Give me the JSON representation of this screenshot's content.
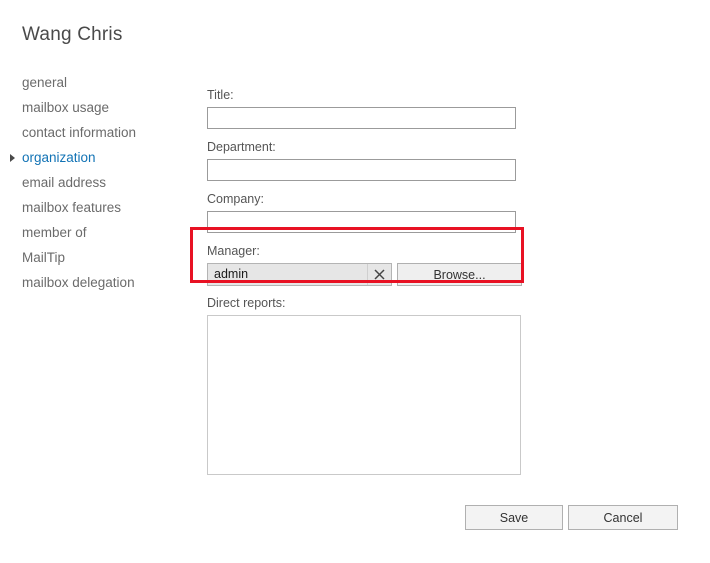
{
  "page": {
    "title": "Wang Chris"
  },
  "sidebar": {
    "items": [
      {
        "label": "general",
        "selected": false
      },
      {
        "label": "mailbox usage",
        "selected": false
      },
      {
        "label": "contact information",
        "selected": false
      },
      {
        "label": "organization",
        "selected": true
      },
      {
        "label": "email address",
        "selected": false
      },
      {
        "label": "mailbox features",
        "selected": false
      },
      {
        "label": "member of",
        "selected": false
      },
      {
        "label": "MailTip",
        "selected": false
      },
      {
        "label": "mailbox delegation",
        "selected": false
      }
    ]
  },
  "form": {
    "title_label": "Title:",
    "title_value": "",
    "title_placeholder": "",
    "department_label": "Department:",
    "department_value": "",
    "department_placeholder": "",
    "company_label": "Company:",
    "company_value": "",
    "company_placeholder": "",
    "manager_label": "Manager:",
    "manager_value": "admin",
    "manager_clear_icon": "close-x-icon",
    "browse_label": "Browse...",
    "direct_reports_label": "Direct reports:",
    "direct_reports_items": []
  },
  "footer": {
    "save_label": "Save",
    "cancel_label": "Cancel"
  },
  "annotation": {
    "highlight_color": "#e81123",
    "target": "manager-field"
  },
  "colors": {
    "accent_blue": "#1273b5",
    "label_gray": "#555555",
    "nav_gray": "#6b6b6b",
    "highlight_red": "#e81123"
  }
}
